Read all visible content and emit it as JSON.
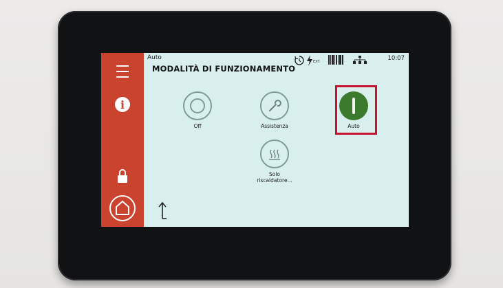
{
  "header": {
    "breadcrumb": "Auto",
    "title": "MODALITÀ DI FUNZIONAMENTO",
    "time": "10:07",
    "ext_label": "EXT."
  },
  "modes": [
    {
      "label": "Off",
      "icon": "off-icon",
      "active": false
    },
    {
      "label": "Assistenza",
      "icon": "wrench-icon",
      "active": false
    },
    {
      "label": "Auto",
      "icon": "auto-icon",
      "active": true
    },
    {
      "label": "Solo riscaldatore...",
      "icon": "heater-icon",
      "active": false
    }
  ],
  "colors": {
    "sidebar": "#c9432f",
    "screen": "#d9efee",
    "active_mode": "#3c7b2e",
    "highlight": "#c8102e"
  },
  "sidebar": {
    "items": [
      "menu-icon",
      "info-icon",
      "lock-icon",
      "home-icon"
    ]
  }
}
